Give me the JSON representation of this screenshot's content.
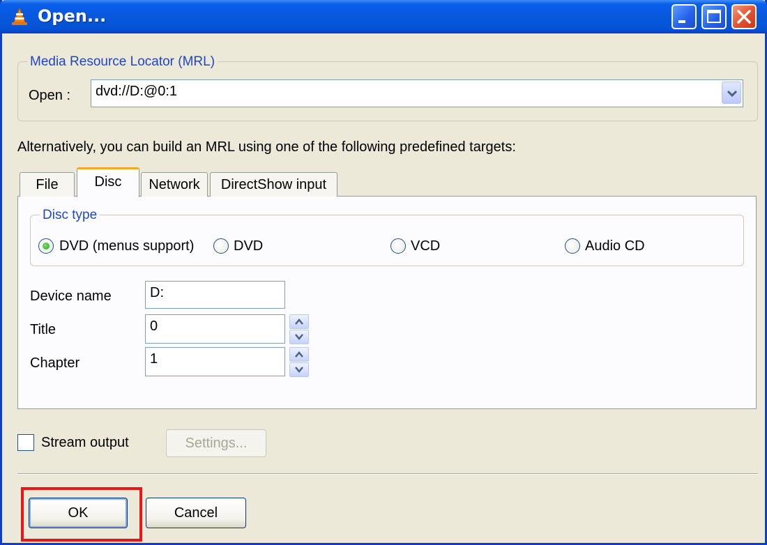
{
  "window": {
    "title": "Open...",
    "controls": [
      "minimize",
      "maximize",
      "close"
    ]
  },
  "mrl": {
    "legend": "Media Resource Locator (MRL)",
    "open_label": "Open :",
    "open_value": "dvd://D:@0:1"
  },
  "hint": "Alternatively, you can build an MRL using one of the following predefined targets:",
  "tabs": [
    {
      "label": "File"
    },
    {
      "label": "Disc",
      "active": true
    },
    {
      "label": "Network"
    },
    {
      "label": "DirectShow input"
    }
  ],
  "disc": {
    "legend": "Disc type",
    "options": [
      {
        "label": "DVD (menus support)",
        "checked": true
      },
      {
        "label": "DVD",
        "checked": false
      },
      {
        "label": "VCD",
        "checked": false
      },
      {
        "label": "Audio CD",
        "checked": false
      }
    ],
    "device_label": "Device name",
    "device_value": "D:",
    "title_label": "Title",
    "title_value": "0",
    "chapter_label": "Chapter",
    "chapter_value": "1"
  },
  "stream": {
    "label": "Stream output",
    "checked": false,
    "settings_label": "Settings..."
  },
  "buttons": {
    "ok": "OK",
    "cancel": "Cancel"
  },
  "colors": {
    "title_bar": "#0758dc",
    "legend_text": "#1f47c4",
    "active_tab_accent": "#f5a623",
    "highlight": "#e8161b"
  }
}
